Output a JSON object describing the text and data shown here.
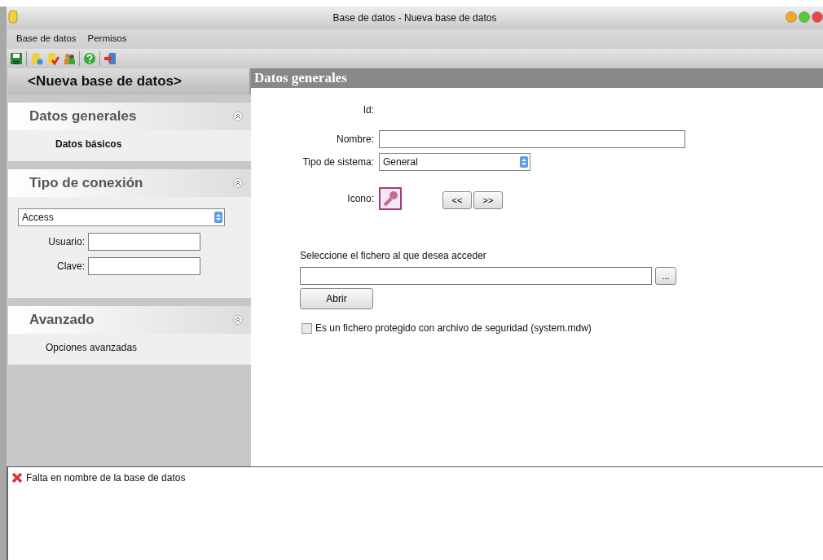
{
  "window": {
    "title": "Base de datos - Nueva base de datos"
  },
  "menu": [
    "Base de datos",
    "Permisos"
  ],
  "sidebar": {
    "title": "<Nueva base de datos>",
    "sections": [
      {
        "kind": "links",
        "title": "Datos generales",
        "expanded": true,
        "items": [
          {
            "label": "Datos básicos",
            "selected": true
          }
        ]
      },
      {
        "kind": "connection",
        "title": "Tipo de conexión",
        "expanded": true,
        "select": "Access",
        "fields": [
          {
            "label": "Usuario:"
          },
          {
            "label": "Clave:"
          }
        ]
      },
      {
        "kind": "links",
        "title": "Avanzado",
        "expanded": true,
        "items": [
          {
            "label": "Opciones avanzadas",
            "selected": false
          }
        ]
      }
    ]
  },
  "content": {
    "title": "Datos generales",
    "id_label": "Id:",
    "name_label": "Nombre:",
    "system_label": "Tipo de sistema:",
    "system_value": "General",
    "icon_label": "Icono:",
    "prev_button": "<<",
    "next_button": ">>",
    "file_label": "Seleccione el fichero al que desea acceder",
    "browse_button": "...",
    "open_button": "Abrir",
    "secure_checkbox": {
      "label": "Es un fichero protegido con archivo de seguridad (system.mdw)",
      "checked": false
    }
  },
  "messages": [
    {
      "kind": "error",
      "text": "Falta en nombre de la base de datos"
    }
  ]
}
